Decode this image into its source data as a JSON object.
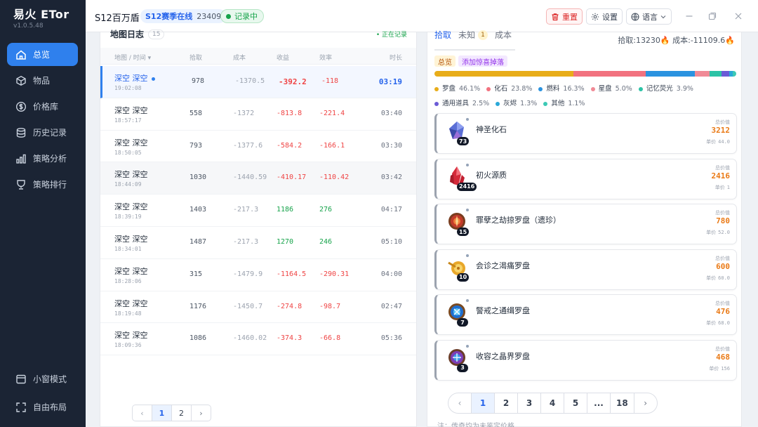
{
  "app": {
    "name": "易火 ETor",
    "version": "v1.0.5.48"
  },
  "sidebar": {
    "items": [
      {
        "label": "总览",
        "icon": "home-icon",
        "active": true
      },
      {
        "label": "物品",
        "icon": "box-icon"
      },
      {
        "label": "价格库",
        "icon": "dollar-icon"
      },
      {
        "label": "历史记录",
        "icon": "database-icon"
      },
      {
        "label": "策略分析",
        "icon": "bar-chart-icon"
      },
      {
        "label": "策略排行",
        "icon": "trophy-icon"
      }
    ],
    "bottom": [
      {
        "label": "小窗模式",
        "icon": "window-icon"
      },
      {
        "label": "自由布局",
        "icon": "expand-icon"
      }
    ]
  },
  "header": {
    "title": "S12百万盾",
    "season_label": "S12赛季在线",
    "season_count": "23409",
    "record_status": "记录中",
    "reset_label": "重置",
    "settings_label": "设置",
    "language_label": "语言"
  },
  "log": {
    "title": "地图日志",
    "count": "15",
    "status": "• 正在记录",
    "columns": {
      "map": "地图 / 时间 ▾",
      "pickup": "拾取",
      "cost": "成本",
      "profit": "收益",
      "efficiency": "效率",
      "duration": "时长"
    },
    "rows": [
      {
        "map": "深空 深空",
        "time": "19:02:08",
        "pickup": "978",
        "cost": "-1370.5",
        "profit": "-392.2",
        "efficiency": "-118",
        "duration": "03:19"
      },
      {
        "map": "深空 深空",
        "time": "18:57:17",
        "pickup": "558",
        "cost": "-1372",
        "profit": "-813.8",
        "efficiency": "-221.4",
        "duration": "03:40"
      },
      {
        "map": "深空 深空",
        "time": "18:50:05",
        "pickup": "793",
        "cost": "-1377.6",
        "profit": "-584.2",
        "efficiency": "-166.1",
        "duration": "03:30"
      },
      {
        "map": "深空 深空",
        "time": "18:44:09",
        "pickup": "1030",
        "cost": "-1440.59",
        "profit": "-410.17",
        "efficiency": "-110.42",
        "duration": "03:42"
      },
      {
        "map": "深空 深空",
        "time": "18:39:19",
        "pickup": "1403",
        "cost": "-217.3",
        "profit": "1186",
        "efficiency": "276",
        "duration": "04:17"
      },
      {
        "map": "深空 深空",
        "time": "18:34:01",
        "pickup": "1487",
        "cost": "-217.3",
        "profit": "1270",
        "efficiency": "246",
        "duration": "05:10"
      },
      {
        "map": "深空 深空",
        "time": "18:28:06",
        "pickup": "315",
        "cost": "-1479.9",
        "profit": "-1164.5",
        "efficiency": "-290.31",
        "duration": "04:00"
      },
      {
        "map": "深空 深空",
        "time": "18:19:48",
        "pickup": "1176",
        "cost": "-1450.7",
        "profit": "-274.8",
        "efficiency": "-98.7",
        "duration": "02:47"
      },
      {
        "map": "深空 深空",
        "time": "18:09:36",
        "pickup": "1086",
        "cost": "-1460.02",
        "profit": "-374.3",
        "efficiency": "-66.8",
        "duration": "05:36"
      }
    ],
    "pages": [
      "1",
      "2"
    ]
  },
  "detail": {
    "tabs": [
      "拾取",
      "未知",
      "成本"
    ],
    "unknown_badge": "1",
    "summary": "拾取:13230🔥  成本:-11109.6🔥",
    "chip_total": "总览",
    "chip_add": "添加惊喜掉落",
    "breakdown": [
      {
        "label": "罗盘",
        "pct": "46.1%",
        "value": 46.1,
        "color": "#e8ad1a"
      },
      {
        "label": "化石",
        "pct": "23.8%",
        "value": 23.8,
        "color": "#f2727f"
      },
      {
        "label": "燃料",
        "pct": "16.3%",
        "value": 16.3,
        "color": "#2b93e0"
      },
      {
        "label": "星盘",
        "pct": "5.0%",
        "value": 5.0,
        "color": "#f08a96"
      },
      {
        "label": "记忆荧光",
        "pct": "3.9%",
        "value": 3.9,
        "color": "#2cc3a6"
      },
      {
        "label": "通用道具",
        "pct": "2.5%",
        "value": 2.5,
        "color": "#6b5bd6"
      },
      {
        "label": "灰烬",
        "pct": "1.3%",
        "value": 1.3,
        "color": "#2aa8d8"
      },
      {
        "label": "其他",
        "pct": "1.1%",
        "value": 1.1,
        "color": "#3cc9b5"
      }
    ],
    "total_value_label": "总价值",
    "unit_price_label": "单价",
    "items": [
      {
        "name": "神圣化石",
        "qty": "73",
        "total": "3212",
        "unit": "44.0",
        "icon": "crystal-icon"
      },
      {
        "name": "初火源质",
        "qty": "2416",
        "total": "2416",
        "unit": "1",
        "icon": "red-crystal-icon"
      },
      {
        "name": "罪孽之劫掠罗盘（遗珍）",
        "qty": "15",
        "total": "780",
        "unit": "52.0",
        "icon": "compass-icon"
      },
      {
        "name": "会诊之渴痛罗盘",
        "qty": "10",
        "total": "600",
        "unit": "60.0",
        "icon": "gold-compass-icon"
      },
      {
        "name": "警戒之通缉罗盘",
        "qty": "7",
        "total": "476",
        "unit": "68.0",
        "icon": "blue-compass-icon"
      },
      {
        "name": "收容之晶界罗盘",
        "qty": "3",
        "total": "468",
        "unit": "156",
        "icon": "purple-compass-icon"
      }
    ],
    "pages": [
      "1",
      "2",
      "3",
      "4",
      "5",
      "...",
      "18"
    ],
    "note": "注：传奇均为未鉴定价格"
  }
}
